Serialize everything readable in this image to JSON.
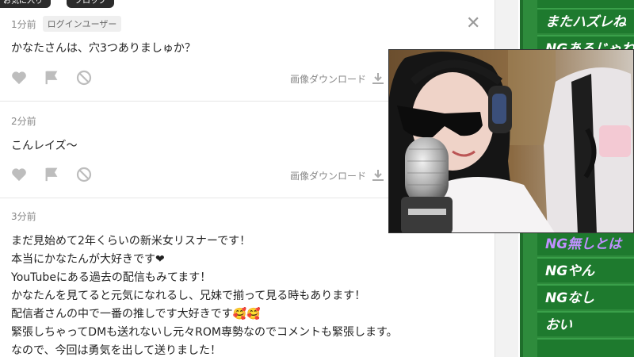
{
  "top_buttons": [
    "お気に入り",
    "フロップ"
  ],
  "comments": [
    {
      "time": "1分前",
      "badge": "ログインユーザー",
      "lines": [
        "かなたさんは、穴3つありましゅか？"
      ],
      "download_label": "画像ダウンロード"
    },
    {
      "time": "2分前",
      "lines": [
        "こんレイズ〜"
      ],
      "download_label": "画像ダウンロード"
    },
    {
      "time": "3分前",
      "lines": [
        "まだ見始めて2年くらいの新米女リスナーです！",
        "本当にかなたんが大好きです❤",
        "YouTubeにある過去の配信もみてます！",
        "かなたんを見てると元気になれるし、兄妹で揃って見る時もあります！",
        "配信者さんの中で一番の推しです大好きです🥰🥰",
        "緊張しちゃってDMも送れないし元々ROM専勢なのでコメントも緊張します。",
        "なので、今回は勇気を出して送りました！"
      ]
    }
  ],
  "ng_panel": {
    "items": [
      {
        "text": "またハズレね",
        "style": "white"
      },
      {
        "text": "NGあるじゃねえ",
        "style": "white"
      },
      {
        "text": "NG無しとは",
        "style": "purple"
      },
      {
        "text": "NGやん",
        "style": "white"
      },
      {
        "text": "NGなし",
        "style": "white"
      },
      {
        "text": "おい",
        "style": "white"
      }
    ]
  },
  "colors": {
    "ng_bg": "#2e8b3c",
    "heart": "#e0245e",
    "meta_gray": "#888888"
  }
}
